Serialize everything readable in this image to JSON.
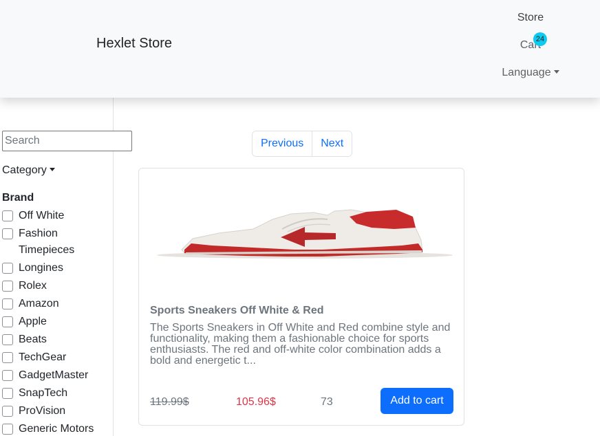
{
  "navbar": {
    "brand": "Hexlet Store",
    "store_label": "Store",
    "cart_label": "Cart",
    "cart_count": "24",
    "language_label": "Language"
  },
  "sidebar": {
    "search_placeholder": "Search",
    "category_label": "Category",
    "brand_title": "Brand",
    "brands": [
      "Off White",
      "Fashion Timepieces",
      "Longines",
      "Rolex",
      "Amazon",
      "Apple",
      "Beats",
      "TechGear",
      "GadgetMaster",
      "SnapTech",
      "ProVision",
      "Generic Motors"
    ]
  },
  "pagination": {
    "previous_label": "Previous",
    "next_label": "Next"
  },
  "product": {
    "title": "Sports Sneakers Off White & Red",
    "description": "The Sports Sneakers in Off White and Red combine style and functionality, making them a fashionable choice for sports enthusiasts. The red and off-white color combination adds a bold and energetic t...",
    "old_price": "119.99$",
    "new_price": "105.96$",
    "stock": "73",
    "add_to_cart_label": "Add to cart",
    "image_icon": "sneaker-image"
  },
  "colors": {
    "primary": "#0d6efd",
    "danger": "#dc3545",
    "info": "#0dcaf0",
    "navbar_bg": "#f8f9fa"
  }
}
